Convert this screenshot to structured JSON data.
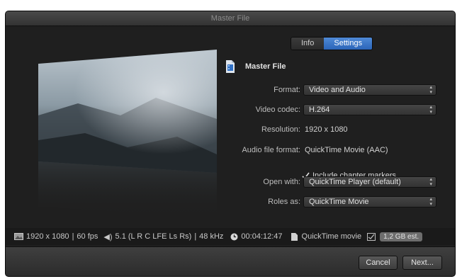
{
  "window": {
    "title": "Master File"
  },
  "tabs": [
    {
      "label": "Info"
    },
    {
      "label": "Settings"
    }
  ],
  "header": {
    "title": "Master File",
    "icon": "document-icon"
  },
  "fields": {
    "format_label": "Format:",
    "format_value": "Video and Audio",
    "video_codec_label": "Video codec:",
    "video_codec_value": "H.264",
    "resolution_label": "Resolution:",
    "resolution_value": "1920 x 1080",
    "audio_format_label": "Audio file format:",
    "audio_format_value": "QuickTime Movie (AAC)",
    "chapter_label": "Include chapter markers",
    "chapter_checked": true,
    "open_with_label": "Open with:",
    "open_with_value": "QuickTime Player (default)",
    "roles_label": "Roles as:",
    "roles_value": "QuickTime Movie"
  },
  "status": {
    "resolution": "1920 x 1080",
    "fps": "60 fps",
    "audio": "5.1 (L R C LFE Ls Rs)",
    "sample_rate": "48 kHz",
    "duration": "00:04:12:47",
    "container": "QuickTime movie",
    "size_estimate": "1,2 GB est."
  },
  "buttons": {
    "cancel": "Cancel",
    "next": "Next..."
  },
  "colors": {
    "accent": "#3a74c8",
    "background": "#1f1f1f"
  }
}
